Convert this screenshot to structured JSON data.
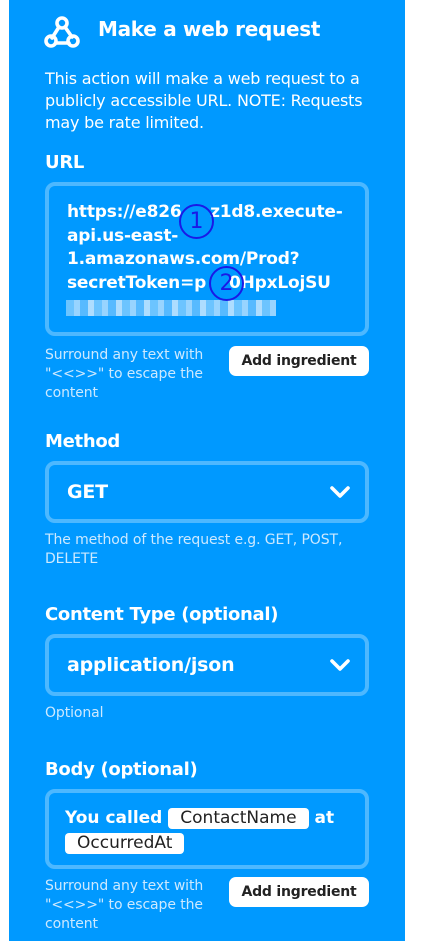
{
  "header": {
    "title": "Make a web request",
    "icon": "webhook-icon"
  },
  "description": "This action will make a web request to a publicly accessible URL. NOTE: Requests may be rate limited.",
  "url_field": {
    "label": "URL",
    "lines": [
      "https://e826",
      "z1d8.execute-",
      "api.us-east-",
      "1.amazonaws.com/Prod?",
      "secretToken=p",
      "0HpxLojSU"
    ],
    "markers": [
      "1",
      "2"
    ],
    "help": [
      "Surround any text with",
      "\"<<>>\" to escape the",
      "content"
    ],
    "add_ingredient": "Add ingredient"
  },
  "method_field": {
    "label": "Method",
    "value": "GET",
    "help": [
      "The method of the request e.g. GET, POST,",
      "DELETE"
    ]
  },
  "content_type_field": {
    "label": "Content Type (optional)",
    "value": "application/json",
    "help": "Optional"
  },
  "body_field": {
    "label": "Body (optional)",
    "text_before": "You called",
    "ingredient_1": "ContactName",
    "text_middle": "at",
    "ingredient_2": "OccurredAt",
    "help": [
      "Surround any text with",
      "\"<<>>\" to escape the",
      "content"
    ],
    "add_ingredient": "Add ingredient"
  },
  "colors": {
    "panel": "#0099ff",
    "field_border": "#4db8ff",
    "marker": "#1a1ae6"
  }
}
